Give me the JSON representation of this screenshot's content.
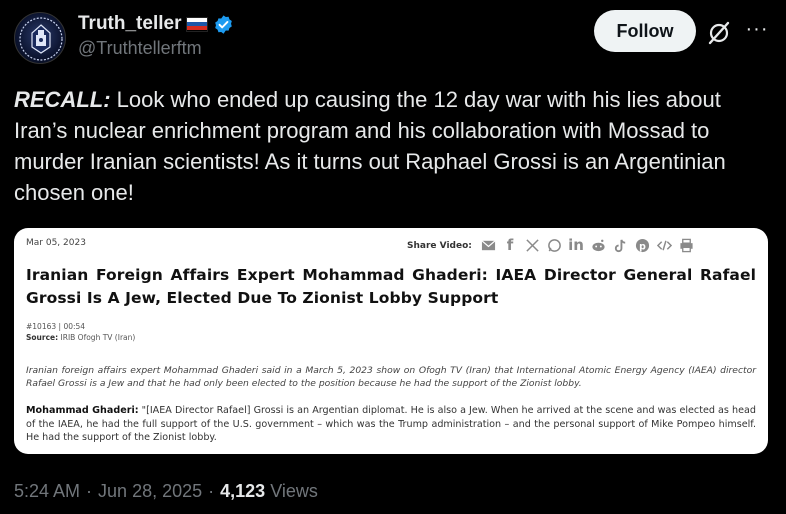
{
  "author": {
    "display_name": "Truth_teller",
    "handle": "@Truthtellerftm",
    "flag_icon": "russian-flag-icon",
    "verified_icon": "verified-badge-icon",
    "verified_color": "#1d9bf0"
  },
  "actions": {
    "follow_label": "Follow",
    "grok_icon": "grok-icon",
    "more_label": "···"
  },
  "tweet": {
    "lead": "RECALL:",
    "body": " Look who ended up causing the 12 day war with his lies about Iran’s nuclear enrichment program and his collaboration with Mossad to murder Iranian scientists! As it turns out Raphael Grossi is an Argentinian chosen one!"
  },
  "card": {
    "date": "Mar 05, 2023",
    "share_label": "Share Video:",
    "share_icons": [
      "email-icon",
      "facebook-icon",
      "x-icon",
      "whatsapp-icon",
      "linkedin-icon",
      "reddit-icon",
      "tiktok-icon",
      "pinterest-icon",
      "embed-icon",
      "print-icon"
    ],
    "headline": "Iranian Foreign Affairs Expert Mohammad Ghaderi: IAEA Director General Rafael Grossi Is A Jew, Elected Due To Zionist Lobby Support",
    "clip_id": "#10163 | 00:54",
    "source_label": "Source:",
    "source_value": "IRIB Ofogh TV (Iran)",
    "summary": "Iranian foreign affairs expert Mohammad Ghaderi said in a March 5, 2023 show on Ofogh TV (Iran) that International Atomic Energy Agency (IAEA) director Rafael Grossi is a Jew and that he had only been elected to the position because he had the support of the Zionist lobby.",
    "speaker": "Mohammad Ghaderi:",
    "quote": " \"[IAEA Director Rafael] Grossi is an Argentian diplomat. He is also a Jew. When he arrived at the scene and was elected as head of the IAEA, he had the full support of the U.S. government – which was the Trump administration – and the personal support of Mike Pompeo himself. He had the support of the Zionist lobby."
  },
  "footer": {
    "time": "5:24 AM",
    "separator1": "·",
    "date": "Jun 28, 2025",
    "separator2": "·",
    "views_count": "4,123",
    "views_label": "Views"
  }
}
